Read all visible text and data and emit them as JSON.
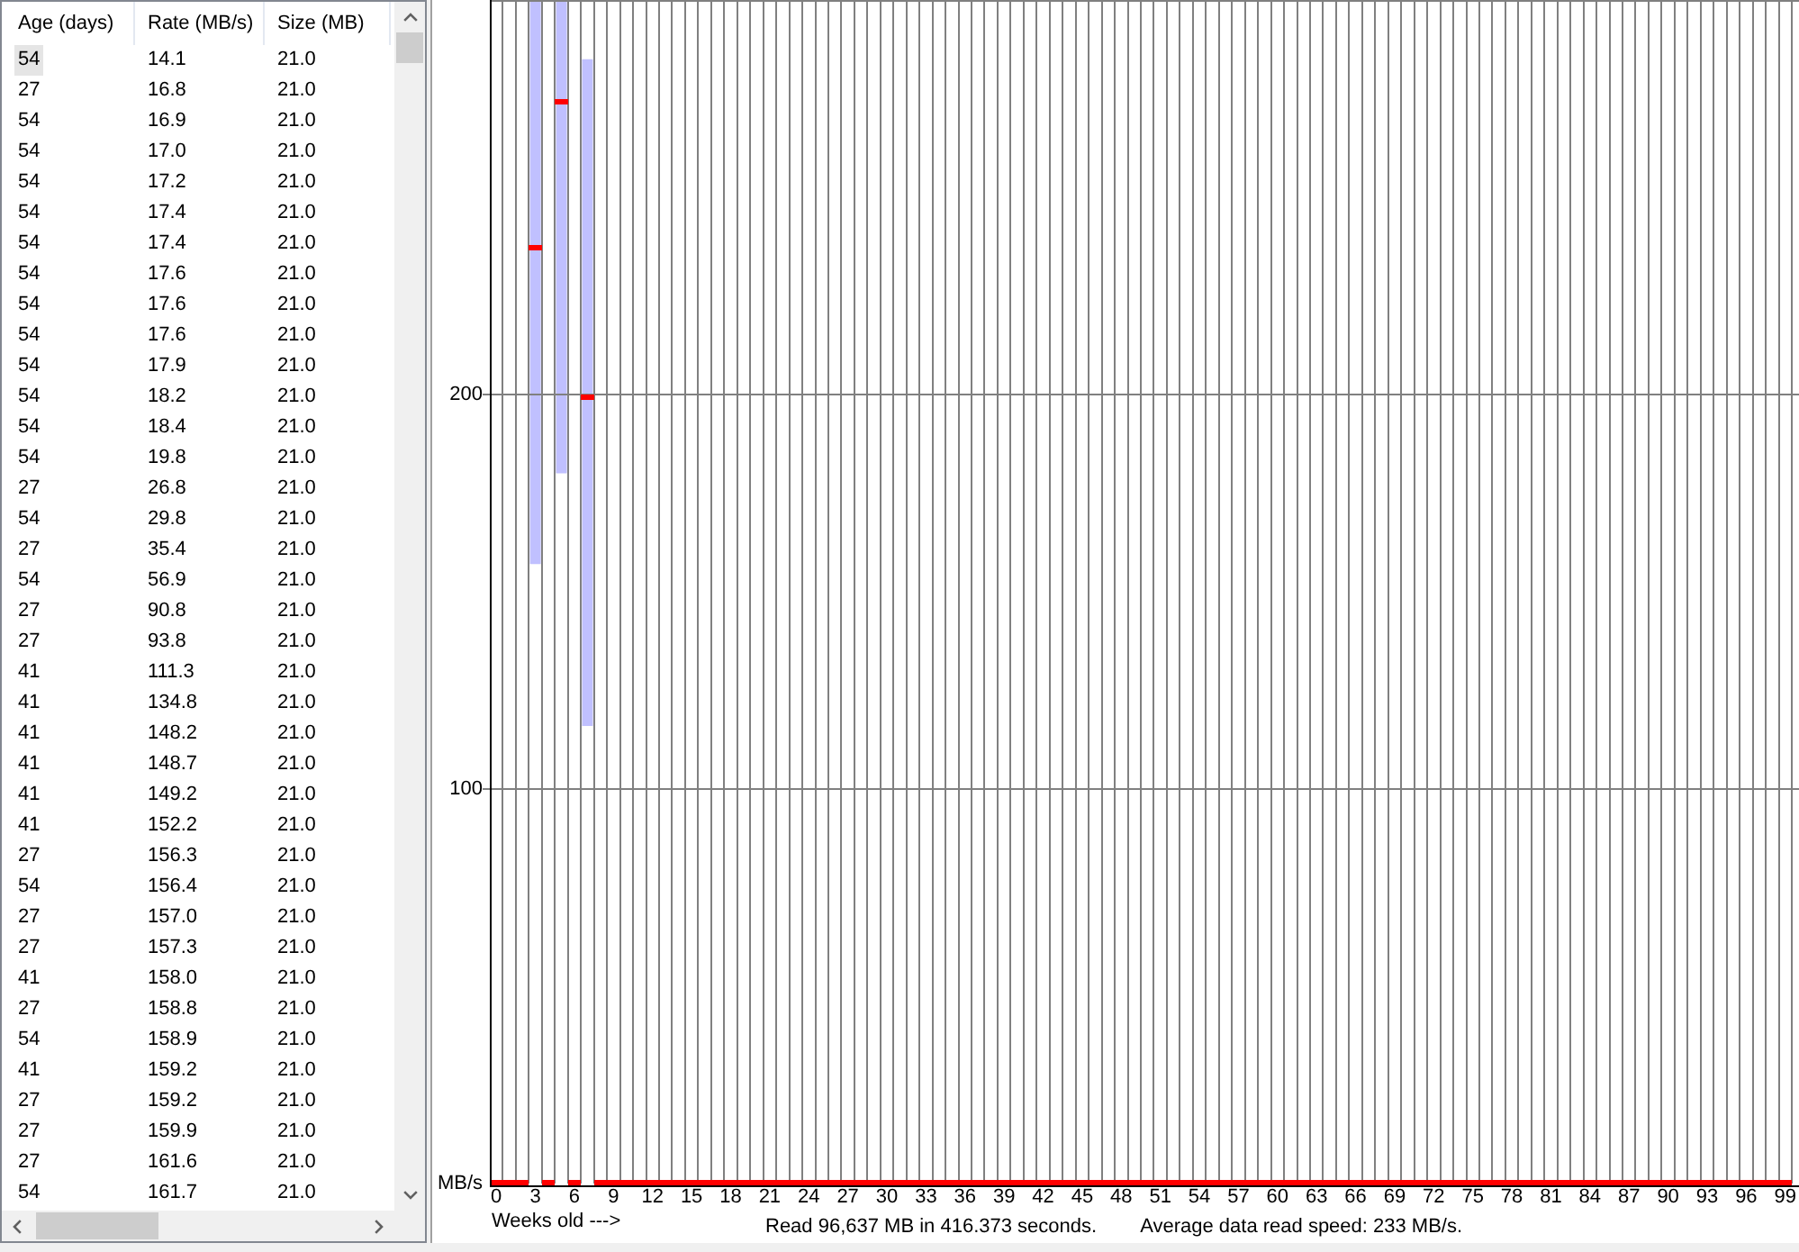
{
  "table": {
    "columns": [
      "Age (days)",
      "Rate (MB/s)",
      "Size (MB)"
    ],
    "rows": [
      {
        "cells": [
          "54",
          "14.1",
          "21.0"
        ],
        "selected": true
      },
      {
        "cells": [
          "27",
          "16.8",
          "21.0"
        ],
        "selected": false
      },
      {
        "cells": [
          "54",
          "16.9",
          "21.0"
        ],
        "selected": false
      },
      {
        "cells": [
          "54",
          "17.0",
          "21.0"
        ],
        "selected": false
      },
      {
        "cells": [
          "54",
          "17.2",
          "21.0"
        ],
        "selected": false
      },
      {
        "cells": [
          "54",
          "17.4",
          "21.0"
        ],
        "selected": false
      },
      {
        "cells": [
          "54",
          "17.4",
          "21.0"
        ],
        "selected": false
      },
      {
        "cells": [
          "54",
          "17.6",
          "21.0"
        ],
        "selected": false
      },
      {
        "cells": [
          "54",
          "17.6",
          "21.0"
        ],
        "selected": false
      },
      {
        "cells": [
          "54",
          "17.6",
          "21.0"
        ],
        "selected": false
      },
      {
        "cells": [
          "54",
          "17.9",
          "21.0"
        ],
        "selected": false
      },
      {
        "cells": [
          "54",
          "18.2",
          "21.0"
        ],
        "selected": false
      },
      {
        "cells": [
          "54",
          "18.4",
          "21.0"
        ],
        "selected": false
      },
      {
        "cells": [
          "54",
          "19.8",
          "21.0"
        ],
        "selected": false
      },
      {
        "cells": [
          "27",
          "26.8",
          "21.0"
        ],
        "selected": false
      },
      {
        "cells": [
          "54",
          "29.8",
          "21.0"
        ],
        "selected": false
      },
      {
        "cells": [
          "27",
          "35.4",
          "21.0"
        ],
        "selected": false
      },
      {
        "cells": [
          "54",
          "56.9",
          "21.0"
        ],
        "selected": false
      },
      {
        "cells": [
          "27",
          "90.8",
          "21.0"
        ],
        "selected": false
      },
      {
        "cells": [
          "27",
          "93.8",
          "21.0"
        ],
        "selected": false
      },
      {
        "cells": [
          "41",
          "111.3",
          "21.0"
        ],
        "selected": false
      },
      {
        "cells": [
          "41",
          "134.8",
          "21.0"
        ],
        "selected": false
      },
      {
        "cells": [
          "41",
          "148.2",
          "21.0"
        ],
        "selected": false
      },
      {
        "cells": [
          "41",
          "148.7",
          "21.0"
        ],
        "selected": false
      },
      {
        "cells": [
          "41",
          "149.2",
          "21.0"
        ],
        "selected": false
      },
      {
        "cells": [
          "41",
          "152.2",
          "21.0"
        ],
        "selected": false
      },
      {
        "cells": [
          "27",
          "156.3",
          "21.0"
        ],
        "selected": false
      },
      {
        "cells": [
          "54",
          "156.4",
          "21.0"
        ],
        "selected": false
      },
      {
        "cells": [
          "27",
          "157.0",
          "21.0"
        ],
        "selected": false
      },
      {
        "cells": [
          "27",
          "157.3",
          "21.0"
        ],
        "selected": false
      },
      {
        "cells": [
          "41",
          "158.0",
          "21.0"
        ],
        "selected": false
      },
      {
        "cells": [
          "27",
          "158.8",
          "21.0"
        ],
        "selected": false
      },
      {
        "cells": [
          "54",
          "158.9",
          "21.0"
        ],
        "selected": false
      },
      {
        "cells": [
          "41",
          "159.2",
          "21.0"
        ],
        "selected": false
      },
      {
        "cells": [
          "27",
          "159.2",
          "21.0"
        ],
        "selected": false
      },
      {
        "cells": [
          "27",
          "159.9",
          "21.0"
        ],
        "selected": false
      },
      {
        "cells": [
          "27",
          "161.6",
          "21.0"
        ],
        "selected": false
      },
      {
        "cells": [
          "54",
          "161.7",
          "21.0"
        ],
        "selected": false
      }
    ]
  },
  "chart": {
    "chart_data": {
      "type": "scatter",
      "xlabel": "Weeks old --->",
      "ylabel": "MB/s",
      "grid": true,
      "x": [
        0.5,
        1.5,
        2.5,
        3.5,
        4.5,
        5.5,
        6.5,
        7.5,
        8.5,
        9.5,
        10.5,
        11.5,
        12.5,
        13.5,
        14.5,
        15.5,
        16.5,
        17.5,
        18.5,
        19.5,
        20.5,
        21.5,
        22.5,
        23.5,
        24.5,
        25.5,
        26.5,
        27.5,
        28.5,
        29.5,
        30.5,
        31.5,
        32.5,
        33.5,
        34.5,
        35.5,
        36.5,
        37.5,
        38.5,
        39.5,
        40.5,
        41.5,
        42.5,
        43.5,
        44.5,
        45.5,
        46.5,
        47.5,
        48.5,
        49.5,
        50.5,
        51.5,
        52.5,
        53.5,
        54.5,
        55.5,
        56.5,
        57.5,
        58.5,
        59.5,
        60.5,
        61.5,
        62.5,
        63.5,
        64.5,
        65.5,
        66.5,
        67.5,
        68.5,
        69.5,
        70.5,
        71.5,
        72.5,
        73.5,
        74.5,
        75.5,
        76.5,
        77.5,
        78.5,
        79.5,
        80.5,
        81.5,
        82.5,
        83.5,
        84.5,
        85.5,
        86.5,
        87.5,
        88.5,
        89.5,
        90.5,
        91.5,
        92.5,
        93.5,
        94.5,
        95.5,
        96.5,
        97.5,
        98.5,
        99.5
      ],
      "series": [
        {
          "color": "#ff0000",
          "values": [
            0,
            0,
            0,
            237,
            0,
            274,
            0,
            199,
            0,
            0,
            0,
            0,
            0,
            0,
            0,
            0,
            0,
            0,
            0,
            0,
            0,
            0,
            0,
            0,
            0,
            0,
            0,
            0,
            0,
            0,
            0,
            0,
            0,
            0,
            0,
            0,
            0,
            0,
            0,
            0,
            0,
            0,
            0,
            0,
            0,
            0,
            0,
            0,
            0,
            0,
            0,
            0,
            0,
            0,
            0,
            0,
            0,
            0,
            0,
            0,
            0,
            0,
            0,
            0,
            0,
            0,
            0,
            0,
            0,
            0,
            0,
            0,
            0,
            0,
            0,
            0,
            0,
            0,
            0,
            0,
            0,
            0,
            0,
            0,
            0,
            0,
            0,
            0,
            0,
            0,
            0,
            0,
            0,
            0,
            0,
            0,
            0,
            0,
            0,
            0
          ],
          "errors": [
            null,
            null,
            null,
            [
              157,
              300
            ],
            null,
            [
              180,
              300
            ],
            null,
            [
              116,
              285
            ],
            null,
            null,
            null,
            null,
            null,
            null,
            null,
            null,
            null,
            null,
            null,
            null,
            null,
            null,
            null,
            null,
            null,
            null,
            null,
            null,
            null,
            null,
            null,
            null,
            null,
            null,
            null,
            null,
            null,
            null,
            null,
            null,
            null,
            null,
            null,
            null,
            null,
            null,
            null,
            null,
            null,
            null,
            null,
            null,
            null,
            null,
            null,
            null,
            null,
            null,
            null,
            null,
            null,
            null,
            null,
            null,
            null,
            null,
            null,
            null,
            null,
            null,
            null,
            null,
            null,
            null,
            null,
            null,
            null,
            null,
            null,
            null,
            null,
            null,
            null,
            null,
            null,
            null,
            null,
            null,
            null,
            null,
            null,
            null,
            null,
            null,
            null,
            null,
            null,
            null,
            null,
            null
          ]
        }
      ],
      "xlim": [
        0,
        100
      ],
      "ylim": [
        0,
        300
      ],
      "xticks": [
        0,
        3,
        6,
        9,
        12,
        15,
        18,
        21,
        24,
        27,
        30,
        33,
        36,
        39,
        42,
        45,
        48,
        51,
        54,
        57,
        60,
        63,
        66,
        69,
        72,
        75,
        78,
        81,
        84,
        87,
        90,
        93,
        96,
        99
      ],
      "yticks": [
        100,
        200
      ]
    }
  },
  "status": [
    "Read 96,637 MB in 416.373 seconds.",
    "Average data read speed: 233 MB/s."
  ]
}
